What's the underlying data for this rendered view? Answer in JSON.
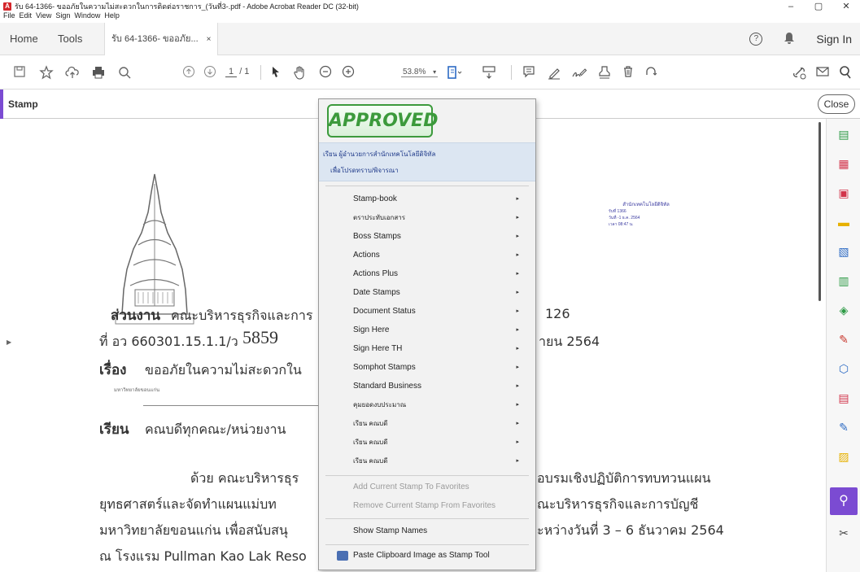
{
  "window": {
    "title": "รับ 64-1366- ขออภัยในความไม่สะดวกในการติดต่อราชการ_(วันที่3-.pdf - Adobe Acrobat Reader DC (32-bit)",
    "minimize": "–",
    "maximize": "▢",
    "close": "✕"
  },
  "menu": [
    "File",
    "Edit",
    "View",
    "Sign",
    "Window",
    "Help"
  ],
  "tabs": {
    "home": "Home",
    "tools": "Tools",
    "doc": "รับ 64-1366- ขออภัย...",
    "doc_close": "×"
  },
  "header_right": {
    "help": "?",
    "sign_in": "Sign In"
  },
  "toolbar": {
    "page_current": "1",
    "page_total": "/ 1",
    "zoom": "53.8%"
  },
  "stamp_bar": {
    "title": "Stamp",
    "close": "Close"
  },
  "document": {
    "dept_label": "ส่วนงาน",
    "dept_value": "คณะบริหารธุรกิจและการ",
    "dept_tail": "126",
    "ref_label": "ที่ อว 660301.15.1.1/ว",
    "ref_number": "5859",
    "date_tail": "ายน 2564",
    "subject_label": "เรื่อง",
    "subject_value": "ขออภัยในความไม่สะดวกใน",
    "to_label": "เรียน",
    "to_value": "คณบดีทุกคณะ/หน่วยงาน",
    "para1_a": "ด้วย คณะบริหารธุร",
    "para1_b": "อบรมเชิงปฏิบัติการทบทวนแผน",
    "para2_a": "ยุทธศาสตร์และจัดทำแผนแม่บท",
    "para2_b": "ณะบริหารธุรกิจและการบัญชี",
    "para3_a": "มหาวิทยาลัยขอนแก่น เพื่อสนับสนุ",
    "para3_b": "ะหว่างวันที่ 3 – 6 ธันวาคม 2564",
    "para4_a": "ณ โรงแรม Pullman Kao Lak Reso",
    "receipt_head": "สำนักเทคโนโลยีดิจิทัล",
    "receipt_l1": "รับที่ 1366",
    "receipt_l2": "วันที่ -1 ธ.ค. 2564",
    "receipt_l3": "เวลา 08:47 น.",
    "logo_caption": "มหาวิทยาลัยขอนแก่น"
  },
  "stamp_menu": {
    "approved": "APPROVED",
    "recent_line1": "เรียน ผู้อำนวยการสำนักเทคโนโลยีดิจิทัล",
    "recent_line2": "เพื่อโปรดทราบ/พิจารณา",
    "items": [
      {
        "label": "Stamp-book",
        "thai": false
      },
      {
        "label": "ตราประทับเอกสาร",
        "thai": true
      },
      {
        "label": " Boss Stamps",
        "thai": false
      },
      {
        "label": "Actions",
        "thai": false
      },
      {
        "label": "Actions Plus",
        "thai": false
      },
      {
        "label": "Date Stamps",
        "thai": false
      },
      {
        "label": "Document Status",
        "thai": false
      },
      {
        "label": "Sign Here",
        "thai": false
      },
      {
        "label": "Sign Here TH",
        "thai": false
      },
      {
        "label": "Somphot Stamps",
        "thai": false
      },
      {
        "label": "Standard Business",
        "thai": false
      },
      {
        "label": "คุมยอดงบประมาณ",
        "thai": true
      },
      {
        "label": "เรียน คณบดี",
        "thai": true
      },
      {
        "label": "เรียน คณบดี",
        "thai": true
      },
      {
        "label": "เรียน คณบดี",
        "thai": true
      }
    ],
    "add_favorite": "Add Current Stamp To Favorites",
    "remove_favorite": "Remove Current Stamp From Favorites",
    "show_names": "Show Stamp Names",
    "paste_clipboard": "Paste Clipboard Image as Stamp Tool",
    "submenu_arrow": "▸"
  },
  "colors": {
    "accent": "#7b4bd2",
    "approved_green": "#3c9a3c",
    "recent_bg": "#dce6f2"
  }
}
